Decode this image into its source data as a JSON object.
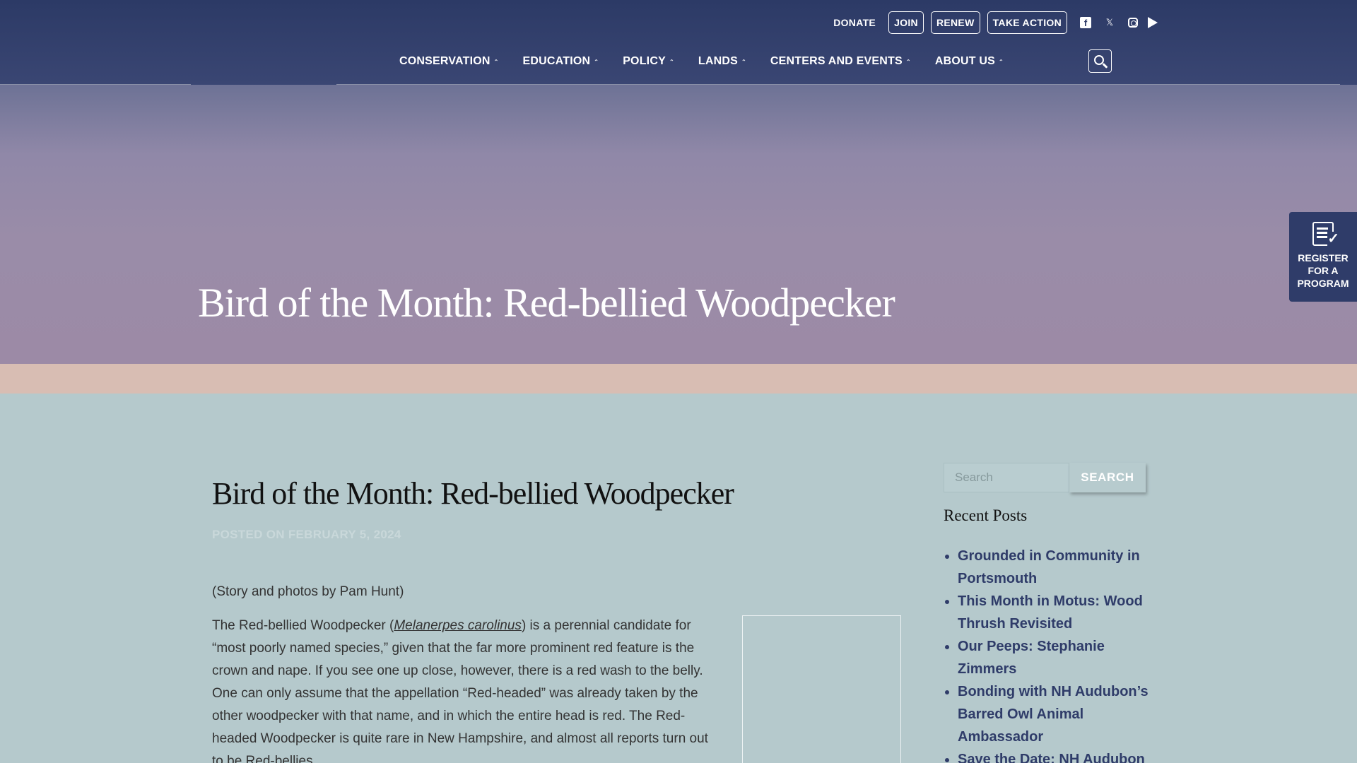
{
  "header": {
    "top_links": {
      "donate": "DONATE",
      "join": "JOIN",
      "renew": "RENEW",
      "take_action": "TAKE ACTION"
    },
    "social": {
      "facebook": "f",
      "x": "𝕏"
    },
    "nav": [
      {
        "label": "CONSERVATION"
      },
      {
        "label": "EDUCATION"
      },
      {
        "label": "POLICY"
      },
      {
        "label": "LANDS"
      },
      {
        "label": "CENTERS AND EVENTS"
      },
      {
        "label": "ABOUT US"
      }
    ]
  },
  "hero": {
    "title": "Bird of the Month: Red-bellied Woodpecker"
  },
  "register_tab": {
    "label_line1": "REGISTER",
    "label_line2": "FOR A",
    "label_line3": "PROGRAM"
  },
  "post": {
    "title": "Bird of the Month: Red-bellied Woodpecker",
    "meta": "POSTED ON FEBRUARY 5, 2024",
    "credit": "(Story and photos by Pam Hunt)",
    "body_pre": "The Red-bellied Woodpecker (",
    "body_sci": "Melanerpes carolinus",
    "body_post": ") is a perennial candidate for “most poorly named species,” given that the far more prominent red feature is the crown and nape. If you see one up close, however, there is a red wash to the belly. One can only assume that the appellation “Red-headed” was already taken by the other woodpecker with that name, and in which the entire head is red. The Red-headed Woodpecker is quite rare in New Hampshire, and almost all reports turn out to be Red-bellies."
  },
  "sidebar": {
    "search_placeholder": "Search",
    "search_button": "SEARCH",
    "recent_heading": "Recent Posts",
    "recent_posts": [
      "Grounded in Community in Portsmouth",
      "This Month in Motus: Wood Thrush Revisited",
      "Our Peeps: Stephanie Zimmers",
      "Bonding with NH Audubon’s Barred Owl Animal Ambassador",
      "Save the Date: NH Audubon"
    ]
  }
}
